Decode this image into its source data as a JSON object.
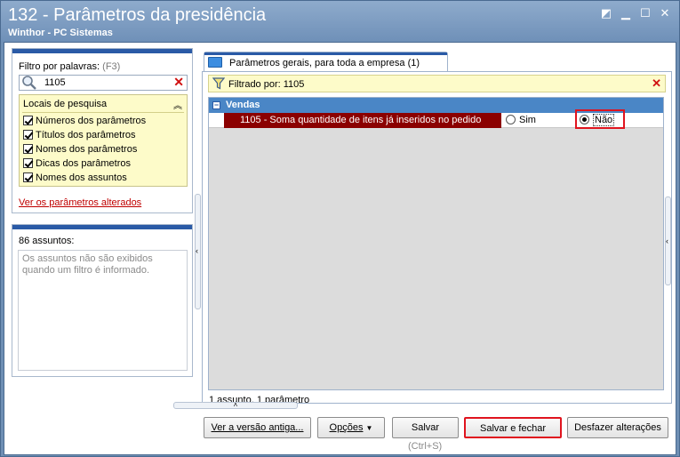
{
  "window": {
    "title": "132 - Parâmetros da presidência",
    "subtitle": "Winthor - PC Sistemas",
    "controls": [
      "restore-down",
      "minimize",
      "maximize",
      "close"
    ]
  },
  "filter": {
    "label": "Filtro por palavras:",
    "shortcut": "(F3)",
    "value": "1105",
    "clear_symbol": "✕"
  },
  "locais": {
    "title": "Locais de pesquisa",
    "options": [
      {
        "label": "Números dos parâmetros",
        "checked": true
      },
      {
        "label": "Títulos dos parâmetros",
        "checked": true
      },
      {
        "label": "Nomes dos parâmetros",
        "checked": true
      },
      {
        "label": "Dicas dos parâmetros",
        "checked": true
      },
      {
        "label": "Nomes dos assuntos",
        "checked": true
      }
    ]
  },
  "link_alterados": "Ver os parâmetros alterados",
  "assuntos": {
    "count_label": "86 assuntos:",
    "message": "Os assuntos não são exibidos quando um filtro é informado."
  },
  "tab": {
    "label": "Parâmetros gerais, para toda a empresa",
    "count": "(1)"
  },
  "filter_bar": {
    "text": "Filtrado por: 1105"
  },
  "grid": {
    "group_label": "Vendas",
    "param_label": "1105 - Soma quantidade de itens já inseridos no pedido",
    "option_sim": "Sim",
    "option_nao": "Não",
    "selected": "Não"
  },
  "status": "1 assunto, 1 parâmetro",
  "buttons": {
    "versao_antiga": "Ver a versão antiga...",
    "opcoes": "Opções",
    "salvar": "Salvar",
    "salvar_hint": "(Ctrl+S)",
    "salvar_fechar": "Salvar e fechar",
    "desfazer": "Desfazer alterações"
  },
  "colors": {
    "accent": "#2a5aa6",
    "group_header": "#4a86c6",
    "param_selected": "#8b0000",
    "highlight": "#e0141e",
    "yellow_panel": "#fdfbc9"
  }
}
